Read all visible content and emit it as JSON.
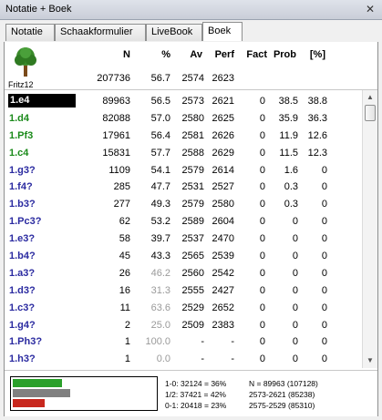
{
  "window": {
    "title": "Notatie + Boek",
    "close_glyph": "✕"
  },
  "tabs": [
    {
      "label": "Notatie",
      "active": false
    },
    {
      "label": "Schaakformulier",
      "active": false
    },
    {
      "label": "LiveBook",
      "active": false
    },
    {
      "label": "Boek",
      "active": true
    }
  ],
  "header": {
    "engine": "Fritz12",
    "columns": {
      "n": "N",
      "pct": "%",
      "av": "Av",
      "perf": "Perf",
      "fact": "Fact",
      "prob": "Prob",
      "pbr": "[%]"
    },
    "totals": {
      "n": "207736",
      "pct": "56.7",
      "av": "2574",
      "perf": "2623"
    }
  },
  "moves": [
    {
      "move": "1.e4",
      "n": "89963",
      "pct": "56.5",
      "av": "2573",
      "perf": "2621",
      "fact": "0",
      "prob": "38.5",
      "pbr": "38.8",
      "style": "sel"
    },
    {
      "move": "1.d4",
      "n": "82088",
      "pct": "57.0",
      "av": "2580",
      "perf": "2625",
      "fact": "0",
      "prob": "35.9",
      "pbr": "36.3",
      "style": "green"
    },
    {
      "move": "1.Pf3",
      "n": "17961",
      "pct": "56.4",
      "av": "2581",
      "perf": "2626",
      "fact": "0",
      "prob": "11.9",
      "pbr": "12.6",
      "style": "green"
    },
    {
      "move": "1.c4",
      "n": "15831",
      "pct": "57.7",
      "av": "2588",
      "perf": "2629",
      "fact": "0",
      "prob": "11.5",
      "pbr": "12.3",
      "style": "green"
    },
    {
      "move": "1.g3?",
      "n": "1109",
      "pct": "54.1",
      "av": "2579",
      "perf": "2614",
      "fact": "0",
      "prob": "1.6",
      "pbr": "0",
      "style": "blue"
    },
    {
      "move": "1.f4?",
      "n": "285",
      "pct": "47.7",
      "av": "2531",
      "perf": "2527",
      "fact": "0",
      "prob": "0.3",
      "pbr": "0",
      "style": "blue"
    },
    {
      "move": "1.b3?",
      "n": "277",
      "pct": "49.3",
      "av": "2579",
      "perf": "2580",
      "fact": "0",
      "prob": "0.3",
      "pbr": "0",
      "style": "blue"
    },
    {
      "move": "1.Pc3?",
      "n": "62",
      "pct": "53.2",
      "av": "2589",
      "perf": "2604",
      "fact": "0",
      "prob": "0",
      "pbr": "0",
      "style": "blue"
    },
    {
      "move": "1.e3?",
      "n": "58",
      "pct": "39.7",
      "av": "2537",
      "perf": "2470",
      "fact": "0",
      "prob": "0",
      "pbr": "0",
      "style": "blue"
    },
    {
      "move": "1.b4?",
      "n": "45",
      "pct": "43.3",
      "av": "2565",
      "perf": "2539",
      "fact": "0",
      "prob": "0",
      "pbr": "0",
      "style": "blue"
    },
    {
      "move": "1.a3?",
      "n": "26",
      "pct": "46.2",
      "av": "2560",
      "perf": "2542",
      "fact": "0",
      "prob": "0",
      "pbr": "0",
      "style": "blue",
      "grey_pct": true
    },
    {
      "move": "1.d3?",
      "n": "16",
      "pct": "31.3",
      "av": "2555",
      "perf": "2427",
      "fact": "0",
      "prob": "0",
      "pbr": "0",
      "style": "blue",
      "grey_pct": true
    },
    {
      "move": "1.c3?",
      "n": "11",
      "pct": "63.6",
      "av": "2529",
      "perf": "2652",
      "fact": "0",
      "prob": "0",
      "pbr": "0",
      "style": "blue",
      "grey_pct": true
    },
    {
      "move": "1.g4?",
      "n": "2",
      "pct": "25.0",
      "av": "2509",
      "perf": "2383",
      "fact": "0",
      "prob": "0",
      "pbr": "0",
      "style": "blue",
      "grey_pct": true
    },
    {
      "move": "1.Ph3?",
      "n": "1",
      "pct": "100.0",
      "av": "-",
      "perf": "-",
      "fact": "0",
      "prob": "0",
      "pbr": "0",
      "style": "blue",
      "grey_pct": true
    },
    {
      "move": "1.h3?",
      "n": "1",
      "pct": "0.0",
      "av": "-",
      "perf": "-",
      "fact": "0",
      "prob": "0",
      "pbr": "0",
      "style": "blue",
      "grey_pct": true
    },
    {
      "move": "1.h4?",
      "n": "0",
      "pct": "-",
      "av": "-",
      "perf": "-",
      "fact": "0",
      "prob": "0",
      "pbr": "0",
      "style": "blue"
    },
    {
      "move": "1.a4?",
      "n": "0",
      "pct": "-",
      "av": "-",
      "perf": "-",
      "fact": "0",
      "prob": "0",
      "pbr": "0",
      "style": "blue"
    }
  ],
  "summary": {
    "bars": [
      {
        "color": "#2aa02a",
        "fraction": 0.36
      },
      {
        "color": "#808080",
        "fraction": 0.42
      },
      {
        "color": "#c8281e",
        "fraction": 0.23
      }
    ],
    "lines_left": [
      "1-0: 32124 = 36%",
      "1/2: 37421 = 42%",
      "0-1: 20418 = 23%"
    ],
    "lines_right": [
      "N = 89963 (107128)",
      "2573-2621 (85238)",
      "2575-2529 (85310)"
    ]
  },
  "colors": {
    "green_move": "#1a8a1a",
    "blue_move": "#2a2aa0",
    "selected_bg": "#000000"
  }
}
